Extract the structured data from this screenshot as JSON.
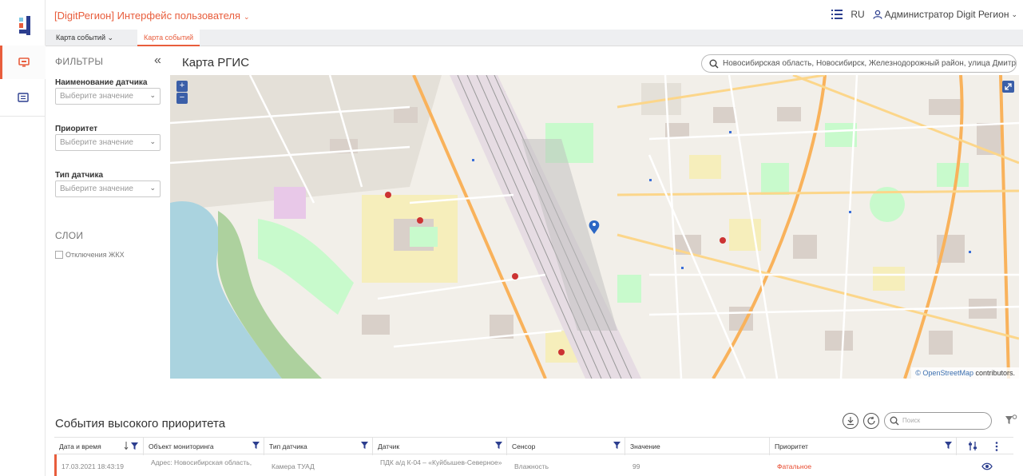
{
  "header": {
    "app_title": "[DigitРегион] Интерфейс пользователя",
    "lang": "RU",
    "user": "Администратор Digit Регион"
  },
  "tabs": [
    {
      "label": "Карта событий",
      "active": false
    },
    {
      "label": "Карта событий",
      "active": true
    }
  ],
  "filters": {
    "title": "ФИЛЬТРЫ",
    "fields": [
      {
        "label": "Наименование датчика",
        "placeholder": "Выберите значение"
      },
      {
        "label": "Приоритет",
        "placeholder": "Выберите значение"
      },
      {
        "label": "Тип датчика",
        "placeholder": "Выберите значение"
      }
    ],
    "layers_title": "СЛОИ",
    "layers": [
      {
        "label": "Отключения ЖКХ",
        "checked": false
      }
    ]
  },
  "map": {
    "title": "Карта РГИС",
    "address": "Новосибирская область, Новосибирск, Железнодорожный район, улица Дмитрия Ш",
    "zoom_in": "+",
    "zoom_out": "−",
    "attribution_link": "© OpenStreetMap",
    "attribution_rest": " contributors."
  },
  "events": {
    "title": "События высокого приоритета",
    "search_placeholder": "Поиск",
    "columns": [
      "Дата и время",
      "Объект мониторинга",
      "Тип датчика",
      "Датчик",
      "Сенсор",
      "Значение",
      "Приоритет"
    ],
    "rows": [
      {
        "datetime": "17.03.2021 18:43:19",
        "object": "Адрес: Новосибирская область,",
        "sensor_type": "Камера ТУАД",
        "sensor": "ПДК а/д К-04 – «Куйбышев-Северное»",
        "sensor_kind": "Влажность",
        "value": "99",
        "priority": "Фатальное"
      }
    ]
  },
  "colors": {
    "accent": "#e85d3c",
    "map_blue": "#3b5fa8",
    "water": "#aad3df",
    "park": "#c8facc"
  }
}
